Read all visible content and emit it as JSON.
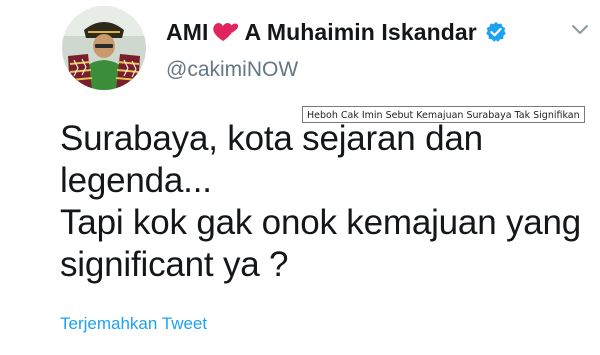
{
  "header": {
    "display_name_prefix": "AMI",
    "display_name": "A Muhaimin Iskandar",
    "handle": "@cakimiNOW",
    "icons": {
      "emoji": "heart-icon",
      "verified": "verified-badge-icon",
      "menu": "chevron-down-icon"
    }
  },
  "tweet": {
    "text": "Surabaya, kota sejaran dan\nlegenda...\nTapi kok gak onok kemajuan yang\nsignificant ya ?",
    "translate_label": "Terjemahkan Tweet"
  },
  "overlay": {
    "caption": "Heboh Cak Imin Sebut Kemajuan Surabaya Tak Signifikan"
  },
  "colors": {
    "text": "#14171a",
    "secondary": "#657786",
    "link": "#1da1f2",
    "verified": "#1da1f2",
    "heart": "#e0245e"
  }
}
